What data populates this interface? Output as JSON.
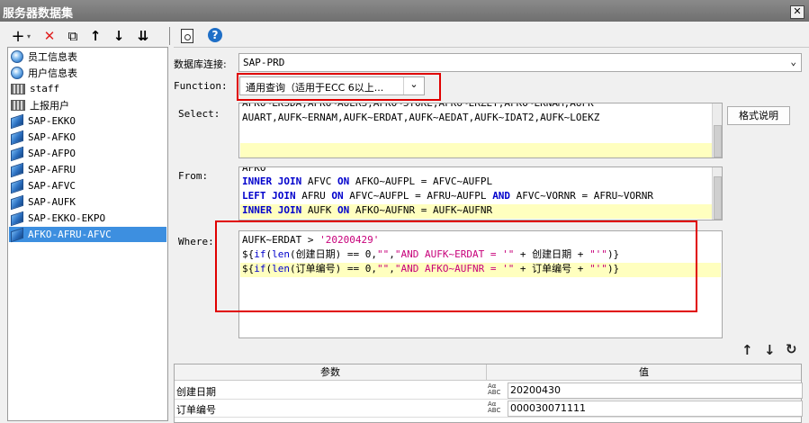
{
  "window": {
    "title": "服务器数据集",
    "close_glyph": "✕"
  },
  "left_toolbar": {
    "add": "+",
    "add_caret": "▾",
    "delete": "✕",
    "copy": "⧉",
    "up": "↑",
    "down": "↓",
    "sort": "⇊"
  },
  "datasets": [
    {
      "label": "员工信息表",
      "icon": "database-icon"
    },
    {
      "label": "用户信息表",
      "icon": "database-icon"
    },
    {
      "label": "staff",
      "icon": "table-grid-icon"
    },
    {
      "label": "上报用户",
      "icon": "table-grid-icon"
    },
    {
      "label": "SAP-EKKO",
      "icon": "sap-cube-icon"
    },
    {
      "label": "SAP-AFKO",
      "icon": "sap-cube-icon"
    },
    {
      "label": "SAP-AFPO",
      "icon": "sap-cube-icon"
    },
    {
      "label": "SAP-AFRU",
      "icon": "sap-cube-icon"
    },
    {
      "label": "SAP-AFVC",
      "icon": "sap-cube-icon"
    },
    {
      "label": "SAP-AUFK",
      "icon": "sap-cube-icon"
    },
    {
      "label": "SAP-EKKO-EKPO",
      "icon": "sap-cube-icon"
    },
    {
      "label": "AFKO-AFRU-AFVC",
      "icon": "sap-cube-icon",
      "selected": true
    }
  ],
  "right_toolbar": {
    "preview_icon": "preview-icon",
    "help_glyph": "?"
  },
  "connection": {
    "label": "数据库连接:",
    "value": "SAP-PRD"
  },
  "function": {
    "label": "Function:",
    "value": "通用查询（适用于ECC 6以上..."
  },
  "select": {
    "label": "Select:",
    "partial_line": "AFKO~LKSDA,AFKO~AUERS,AFKO~STOKE,AFKO~ERZET,AFKO~EKNAM,AUFK",
    "line2": "AUART,AUFK~ERNAM,AUFK~ERDAT,AUFK~AEDAT,AUFK~IDAT2,AUFK~LOEKZ",
    "format_button": "格式说明"
  },
  "from": {
    "label": "From:",
    "partial_line": "AFKO",
    "lines": [
      [
        [
          "INNER JOIN",
          "kw"
        ],
        [
          " AFVC ",
          ""
        ],
        [
          "ON",
          "kw"
        ],
        [
          " AFKO~AUFPL = AFVC~AUFPL",
          ""
        ]
      ],
      [
        [
          "LEFT JOIN",
          "kw"
        ],
        [
          " AFRU ",
          ""
        ],
        [
          "ON",
          "kw"
        ],
        [
          " AFVC~AUFPL = AFRU~AUFPL ",
          ""
        ],
        [
          "AND",
          "kw"
        ],
        [
          " AFVC~VORNR = AFRU~VORNR",
          ""
        ]
      ],
      [
        [
          "INNER JOIN",
          "kw"
        ],
        [
          " AUFK ",
          ""
        ],
        [
          "ON",
          "kw"
        ],
        [
          " AFKO~AUFNR = AUFK~AUFNR",
          ""
        ]
      ]
    ]
  },
  "where": {
    "label": "Where:",
    "lines": [
      [
        [
          "AUFK~ERDAT > ",
          ""
        ],
        [
          "'20200429'",
          "str"
        ]
      ],
      [
        [
          "${",
          ""
        ],
        [
          "if",
          "fn"
        ],
        [
          "(",
          ""
        ],
        [
          "len",
          "fn"
        ],
        [
          "(创建日期) == 0,",
          ""
        ],
        [
          "\"\"",
          "str"
        ],
        [
          ",",
          ""
        ],
        [
          "\"AND AUFK~ERDAT = '\"",
          "str"
        ],
        [
          " + 创建日期 + ",
          ""
        ],
        [
          "\"'\"",
          "str"
        ],
        [
          ")}",
          ""
        ]
      ],
      [
        [
          "${",
          ""
        ],
        [
          "if",
          "fn"
        ],
        [
          "(",
          ""
        ],
        [
          "len",
          "fn"
        ],
        [
          "(订单编号) == 0,",
          ""
        ],
        [
          "\"\"",
          "str"
        ],
        [
          ",",
          ""
        ],
        [
          "\"AND AFKO~AUFNR = '\"",
          "str"
        ],
        [
          " + 订单编号 + ",
          ""
        ],
        [
          "\"'\"",
          "str"
        ],
        [
          ")}",
          ""
        ]
      ]
    ]
  },
  "param_controls": {
    "up": "↑",
    "down": "↓",
    "refresh": "↻"
  },
  "params": {
    "headers": [
      "参数",
      "值"
    ],
    "rows": [
      {
        "name": "创建日期",
        "type_badge": "Aα ABC",
        "value": "20200430"
      },
      {
        "name": "订单编号",
        "type_badge": "Aα ABC",
        "value": "000030071111"
      }
    ]
  },
  "colors": {
    "highlight": "#ffffbf",
    "selection": "#3d8fe0",
    "annotation": "#e00000",
    "keyword": "#0000cc",
    "string": "#c7007a"
  }
}
